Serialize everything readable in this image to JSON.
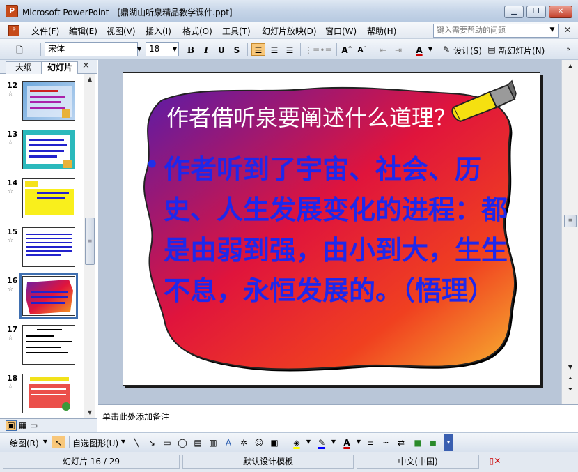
{
  "window": {
    "title": "Microsoft PowerPoint - [鼎湖山听泉精品教学课件.ppt]",
    "app_icon": "powerpoint-icon",
    "controls": [
      "minimize-icon",
      "restore-icon",
      "close-icon"
    ]
  },
  "menubar": {
    "items": [
      {
        "label": "文件(F)"
      },
      {
        "label": "编辑(E)"
      },
      {
        "label": "视图(V)"
      },
      {
        "label": "插入(I)"
      },
      {
        "label": "格式(O)"
      },
      {
        "label": "工具(T)"
      },
      {
        "label": "幻灯片放映(D)"
      },
      {
        "label": "窗口(W)"
      },
      {
        "label": "帮助(H)"
      }
    ],
    "help_placeholder": "键入需要帮助的问题"
  },
  "toolbar": {
    "font_name": "宋体",
    "font_size": "18",
    "bold": "B",
    "italic": "I",
    "underline": "U",
    "shadow": "S",
    "design_label": "设计(S)",
    "new_slide_label": "新幻灯片(N)",
    "font_color": "A"
  },
  "left_pane": {
    "tabs": [
      {
        "label": "大纲",
        "selected": false
      },
      {
        "label": "幻灯片",
        "selected": true
      }
    ],
    "slides": [
      {
        "number": "12",
        "theme": "blue"
      },
      {
        "number": "13",
        "theme": "teal"
      },
      {
        "number": "14",
        "theme": "yellow"
      },
      {
        "number": "15",
        "theme": "white-blue"
      },
      {
        "number": "16",
        "theme": "current",
        "selected": true
      },
      {
        "number": "17",
        "theme": "white"
      },
      {
        "number": "18",
        "theme": "colorful"
      }
    ]
  },
  "slide": {
    "title": "作者借听泉要阐述什么道理？",
    "body": "作者听到了宇宙、社会、历史、人生发展变化的进程：都是由弱到强，由小到大，生生不息，永恒发展的。（悟理）"
  },
  "notes": {
    "placeholder": "单击此处添加备注"
  },
  "drawing_toolbar": {
    "draw_label": "绘图(R)",
    "autoshape_label": "自选图形(U)"
  },
  "statusbar": {
    "slide_info": "幻灯片 16 / 29",
    "template": "默认设计模板",
    "language": "中文(中国)"
  },
  "colors": {
    "title_text": "#ffffff",
    "body_text": "#1e28ec",
    "shape_gradient": [
      "#6a1fa8",
      "#e0143c",
      "#f7a01e"
    ]
  }
}
